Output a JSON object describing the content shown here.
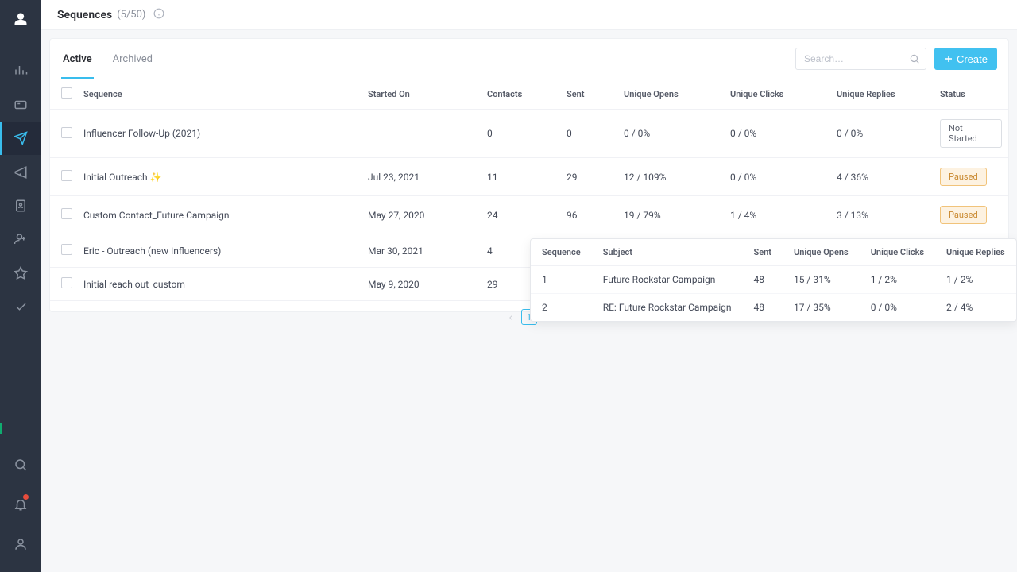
{
  "header": {
    "title": "Sequences",
    "count": "(5/50)"
  },
  "tabs": {
    "active": "Active",
    "archived": "Archived"
  },
  "search": {
    "placeholder": "Search…"
  },
  "buttons": {
    "create": "Create"
  },
  "columns": {
    "sequence": "Sequence",
    "started_on": "Started On",
    "contacts": "Contacts",
    "sent": "Sent",
    "unique_opens": "Unique Opens",
    "unique_clicks": "Unique Clicks",
    "unique_replies": "Unique Replies",
    "status": "Status"
  },
  "status": {
    "not_started": "Not Started",
    "paused": "Paused"
  },
  "rows": [
    {
      "name": "Influencer Follow-Up (2021)",
      "started": "",
      "contacts": "0",
      "sent": "0",
      "opens": "0 / 0%",
      "clicks": "0 / 0%",
      "replies": "0 / 0%",
      "status": "not_started"
    },
    {
      "name": "Initial Outreach ✨",
      "started": "Jul 23, 2021",
      "contacts": "11",
      "sent": "29",
      "opens": "12 / 109%",
      "clicks": "0 / 0%",
      "replies": "4 / 36%",
      "status": "paused"
    },
    {
      "name": "Custom Contact_Future Campaign",
      "started": "May 27, 2020",
      "contacts": "24",
      "sent": "96",
      "opens": "19 / 79%",
      "clicks": "1 / 4%",
      "replies": "3 / 13%",
      "status": "paused"
    },
    {
      "name": "Eric - Outreach (new Influencers)",
      "started": "Mar 30, 2021",
      "contacts": "4",
      "sent": "",
      "opens": "",
      "clicks": "",
      "replies": "",
      "status": ""
    },
    {
      "name": "Initial reach out_custom",
      "started": "May 9, 2020",
      "contacts": "29",
      "sent": "",
      "opens": "",
      "clicks": "",
      "replies": "",
      "status": ""
    }
  ],
  "pagination": {
    "page": "1"
  },
  "popover": {
    "cols": {
      "sequence": "Sequence",
      "subject": "Subject",
      "sent": "Sent",
      "unique_opens": "Unique Opens",
      "unique_clicks": "Unique Clicks",
      "unique_replies": "Unique Replies"
    },
    "rows": [
      {
        "seq": "1",
        "subject": "Future Rockstar Campaign",
        "sent": "48",
        "opens": "15 / 31%",
        "clicks": "1 / 2%",
        "replies": "1 / 2%"
      },
      {
        "seq": "2",
        "subject": "RE: Future Rockstar Campaign",
        "sent": "48",
        "opens": "17 / 35%",
        "clicks": "0 / 0%",
        "replies": "2 / 4%"
      }
    ]
  }
}
